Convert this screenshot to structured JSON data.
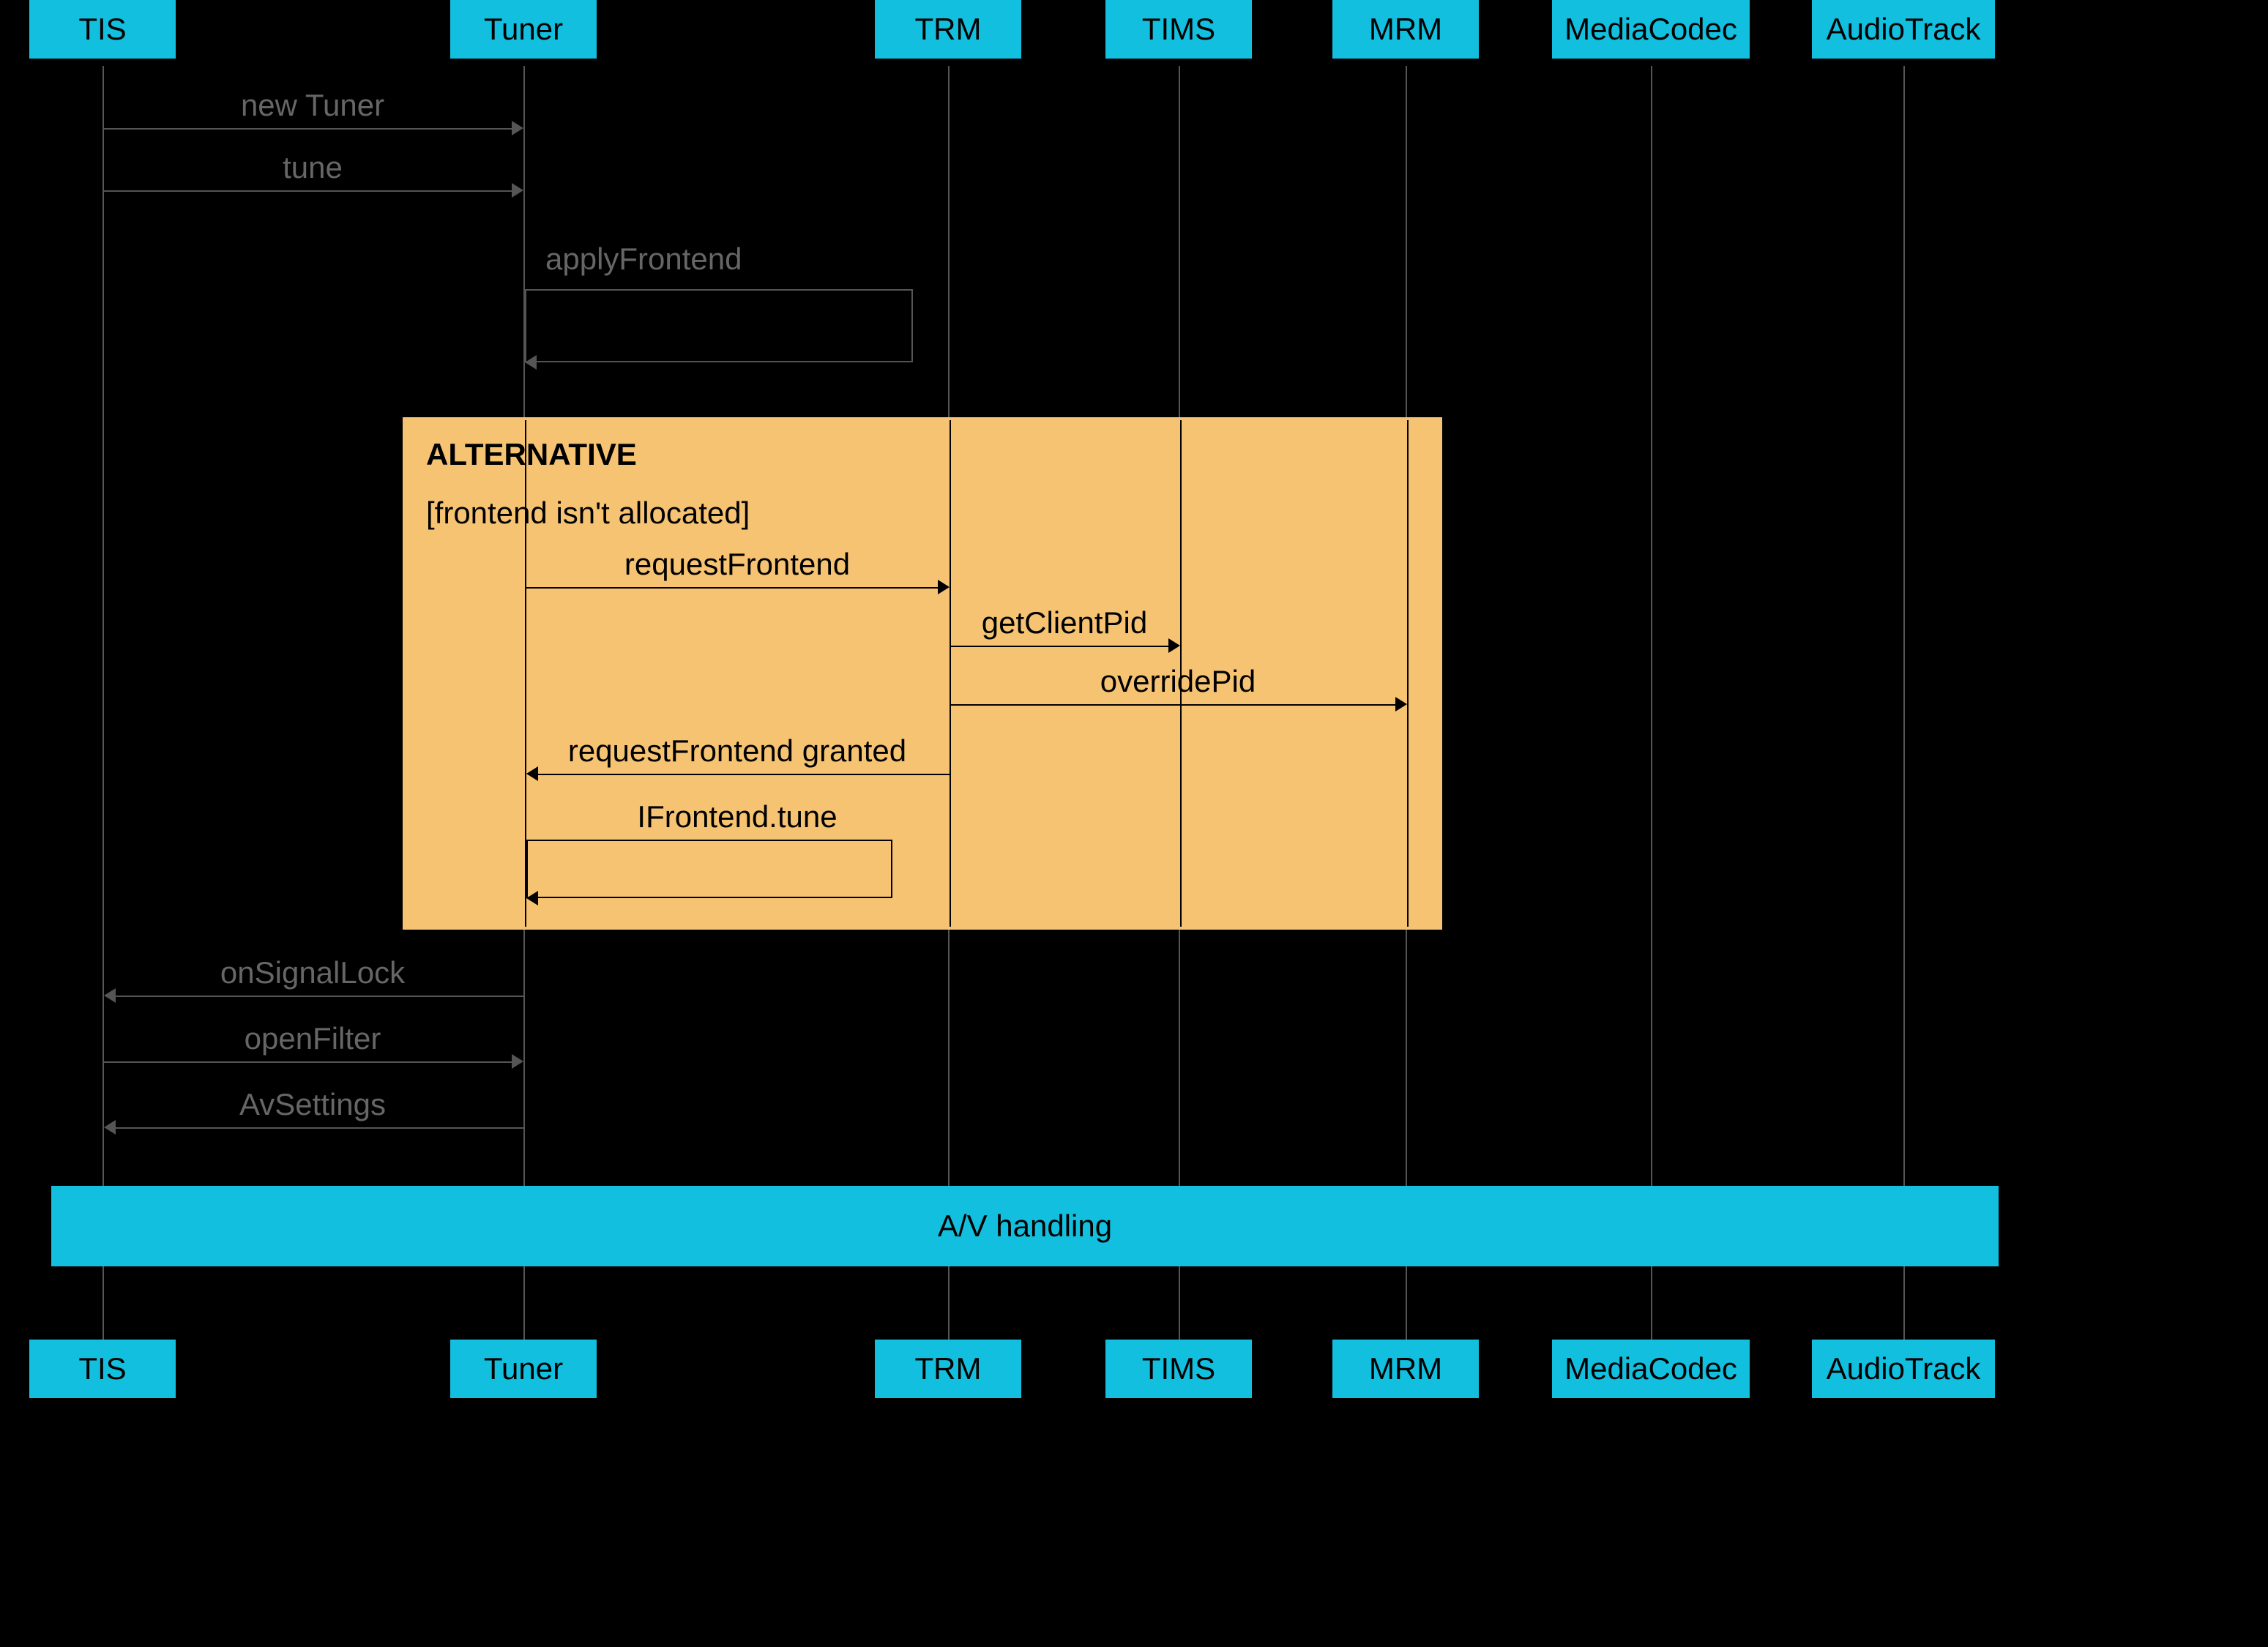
{
  "participants": {
    "p0": "TIS",
    "p1": "Tuner",
    "p2": "TRM",
    "p3": "TIMS",
    "p4": "MRM",
    "p5": "MediaCodec",
    "p6": "AudioTrack"
  },
  "messages": {
    "m0": "new Tuner",
    "m1": "tune",
    "m2": "applyFrontend",
    "m3": "requestFrontend",
    "m4": "getClientPid",
    "m5": "overridePid",
    "m6": "requestFrontend granted",
    "m7": "IFrontend.tune",
    "m8": "onSignalLock",
    "m9": "openFilter",
    "m10": "AvSettings"
  },
  "alt": {
    "title": "ALTERNATIVE",
    "condition": "[frontend isn't allocated]"
  },
  "bar": {
    "av": "A/V handling"
  }
}
